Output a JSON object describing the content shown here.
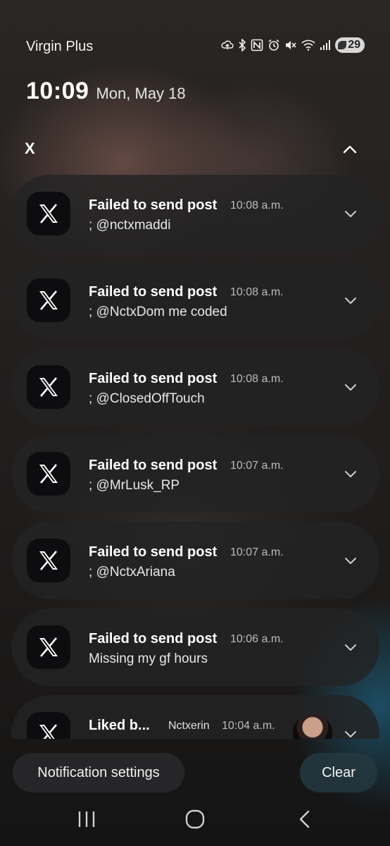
{
  "status_bar": {
    "carrier": "Virgin Plus",
    "battery_level": "29",
    "icons": [
      "cloud-upload-icon",
      "bluetooth-icon",
      "nfc-icon",
      "alarm-icon",
      "mute-icon",
      "wifi-icon",
      "signal-icon",
      "battery-icon"
    ]
  },
  "lock": {
    "time": "10:09",
    "date": "Mon, May 18"
  },
  "group": {
    "app_name": "X"
  },
  "notifications": [
    {
      "title": "Failed to send post",
      "time": "10:08 a.m.",
      "body": "; @nctxmaddi"
    },
    {
      "title": "Failed to send post",
      "time": "10:08 a.m.",
      "body": "; @NctxDom me coded"
    },
    {
      "title": "Failed to send post",
      "time": "10:08 a.m.",
      "body": "; @ClosedOffTouch"
    },
    {
      "title": "Failed to send post",
      "time": "10:07 a.m.",
      "body": "; @MrLusk_RP"
    },
    {
      "title": "Failed to send post",
      "time": "10:07 a.m.",
      "body": "; @NctxAriana"
    },
    {
      "title": "Failed to send post",
      "time": "10:06 a.m.",
      "body": "Missing my gf hours"
    },
    {
      "title": "Liked b...",
      "sender": "Nctxerin",
      "time": "10:04 a.m.",
      "body": ""
    }
  ],
  "actions": {
    "settings_label": "Notification settings",
    "clear_label": "Clear"
  },
  "nav": {
    "icons": [
      "recents-icon",
      "home-icon",
      "back-icon"
    ]
  },
  "colors": {
    "card": "#232325",
    "app_icon_bg": "#0d0d0f",
    "clear_accent": "#243840"
  }
}
